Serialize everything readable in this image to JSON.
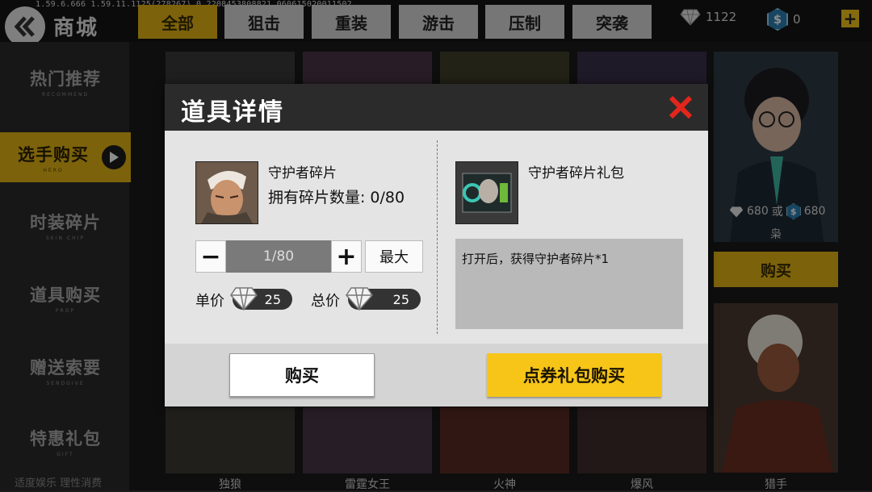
{
  "debug_text": "1.59.6.666  1.59.11.1125(278267)_0_2208453808821   060615020011502",
  "header": {
    "title": "商城",
    "tabs": [
      {
        "label": "全部",
        "active": true
      },
      {
        "label": "狙击",
        "active": false
      },
      {
        "label": "重装",
        "active": false
      },
      {
        "label": "游击",
        "active": false
      },
      {
        "label": "压制",
        "active": false
      },
      {
        "label": "突袭",
        "active": false
      }
    ],
    "diamonds": "1122",
    "coins": "0"
  },
  "sidebar": {
    "items": [
      {
        "label": "热门推荐",
        "sub": "RECOMMEND",
        "active": false
      },
      {
        "label": "选手购买",
        "sub": "HERO",
        "active": true
      },
      {
        "label": "时装碎片",
        "sub": "SKIN CHIP",
        "active": false
      },
      {
        "label": "道具购买",
        "sub": "PROP",
        "active": false
      },
      {
        "label": "赠送索要",
        "sub": "SENDGIVE",
        "active": false
      },
      {
        "label": "特惠礼包",
        "sub": "GIFT",
        "active": false
      }
    ],
    "footer": "适度娱乐  理性消费"
  },
  "background_cards": {
    "names": [
      "独狼",
      "雷霆女王",
      "火神",
      "爆风",
      "猎手"
    ],
    "side_card": {
      "price_gem": "680",
      "or": "或",
      "price_coin": "680",
      "name": "枭",
      "buy_label": "购买"
    }
  },
  "modal": {
    "title": "道具详情",
    "item": {
      "name": "守护者碎片",
      "owned_label": "拥有碎片数量:",
      "owned_value": "0/80"
    },
    "quantity": {
      "value": "1/80",
      "max_label": "最大"
    },
    "unit_price_label": "单价",
    "unit_price": "25",
    "total_price_label": "总价",
    "total_price": "25",
    "pack": {
      "name": "守护者碎片礼包",
      "description": "打开后，获得守护者碎片*1"
    },
    "buy_label": "购买",
    "voucher_buy_label": "点券礼包购买"
  },
  "colors": {
    "accent": "#e2b314",
    "voucher": "#f6c518",
    "close": "#e3261c"
  }
}
